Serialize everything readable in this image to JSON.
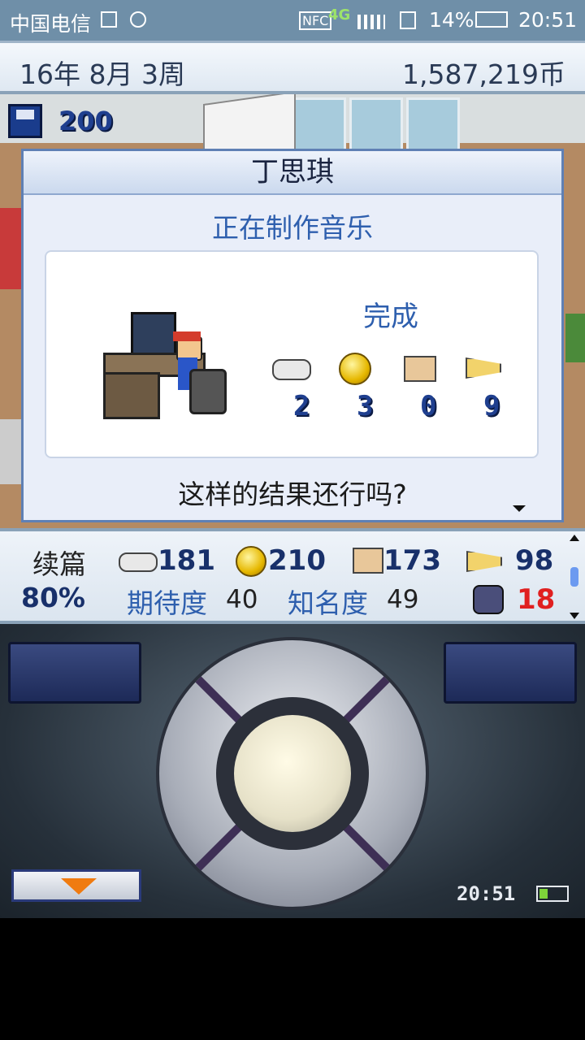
{
  "status_bar": {
    "carrier": "中国电信",
    "battery_percent": "14%",
    "time": "20:51"
  },
  "top_bar": {
    "date": "16年 8月 3周",
    "money": "1,587,219币"
  },
  "save_badge": {
    "count": "200"
  },
  "dialog": {
    "title": "丁思琪",
    "subtitle": "正在制作音乐",
    "status": "完成",
    "stats": [
      "2",
      "3",
      "0",
      "9"
    ],
    "question": "这样的结果还行吗?"
  },
  "stats_panel": {
    "label": "续篇",
    "percent": "80%",
    "values": [
      "181",
      "210",
      "173",
      "98"
    ],
    "expectation_label": "期待度",
    "expectation_value": "40",
    "fame_label": "知名度",
    "fame_value": "49",
    "bug_count": "18"
  },
  "clock": {
    "time": "20:51"
  },
  "colors": {
    "accent": "#5f80b4",
    "bug_red": "#e02020"
  }
}
